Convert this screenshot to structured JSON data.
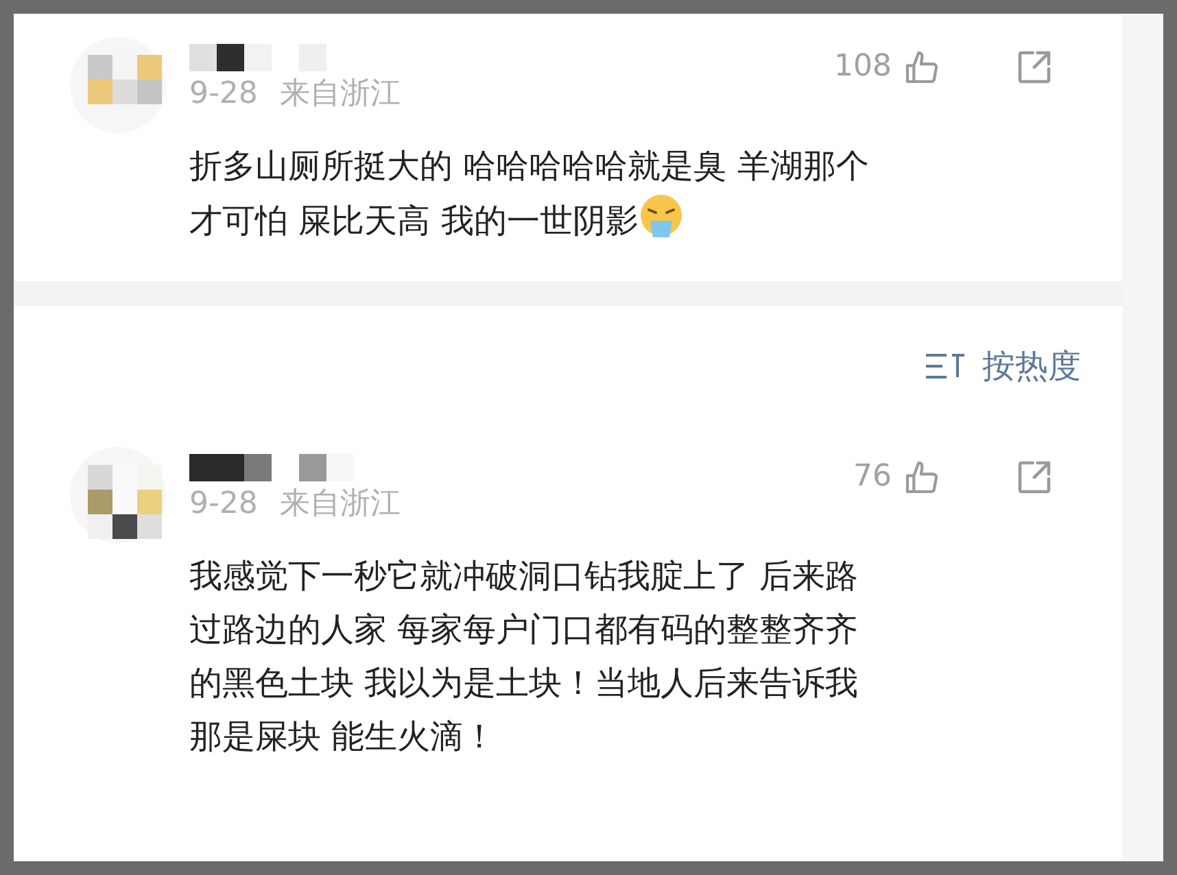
{
  "comments": [
    {
      "date": "9-28",
      "location": "来自浙江",
      "likes": "108",
      "body_lines": [
        "折多山厕所挺大的 哈哈哈哈哈就是臭 羊湖那个",
        "才可怕 屎比天高 我的一世阴影"
      ],
      "emoji": true
    },
    {
      "date": "9-28",
      "location": "来自浙江",
      "likes": "76",
      "body_lines": [
        "我感觉下一秒它就冲破洞口钻我腚上了  后来路",
        "过路边的人家 每家每户门口都有码的整整齐齐",
        "的黑色土块 我以为是土块！当地人后来告诉我",
        "那是屎块  能生火滴！"
      ],
      "emoji": false
    }
  ],
  "sort": {
    "label": "按热度"
  }
}
